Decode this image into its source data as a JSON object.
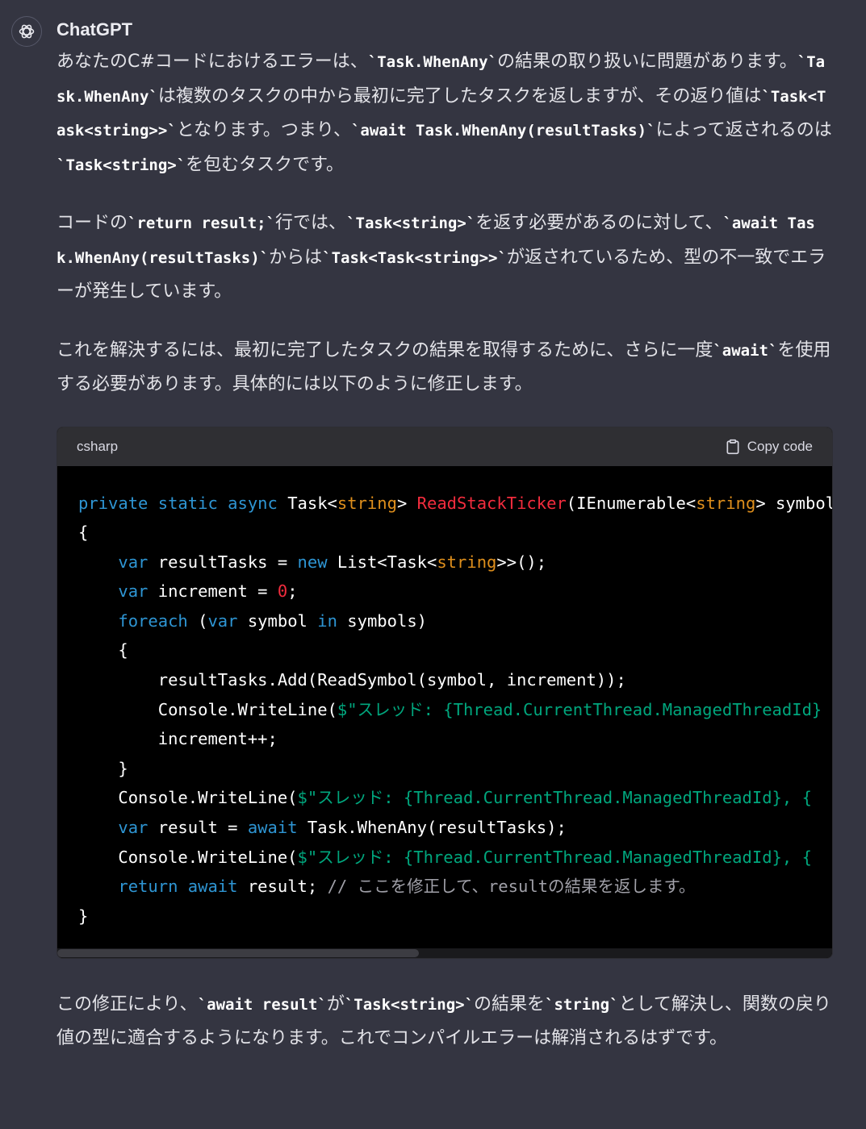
{
  "author": {
    "name": "ChatGPT",
    "avatar_icon": "openai-logo-icon"
  },
  "message": {
    "p1": {
      "t1": "あなたのC#コードにおけるエラーは、",
      "c1": "`Task.WhenAny`",
      "t2": "の結果の取り扱いに問題があります。",
      "c2": "`Task.WhenAny`",
      "t3": "は複数のタスクの中から最初に完了したタスクを返しますが、その返り値は",
      "c3": "`Task<Task<string>>`",
      "t4": "となります。つまり、",
      "c4": "`await Task.WhenAny(resultTasks)`",
      "t5": "によって返されるのは",
      "c5": "`Task<string>`",
      "t6": "を包むタスクです。"
    },
    "p2": {
      "t1": "コードの",
      "c1": "`return result;`",
      "t2": "行では、",
      "c2": "`Task<string>`",
      "t3": "を返す必要があるのに対して、",
      "c3": "`await Task.WhenAny(resultTasks)`",
      "t4": "からは",
      "c4": "`Task<Task<string>>`",
      "t5": "が返されているため、型の不一致でエラーが発生しています。"
    },
    "p3": {
      "t1": "これを解決するには、最初に完了したタスクの結果を取得するために、さらに一度",
      "c1": "`await`",
      "t2": "を使用する必要があります。具体的には以下のように修正します。"
    },
    "p4": {
      "t1": "この修正により、",
      "c1": "`await result`",
      "t2": "が",
      "c2": "`Task<string>`",
      "t3": "の結果を",
      "c3": "`string`",
      "t4": "として解決し、関数の戻り値の型に適合するようになります。これでコンパイルエラーは解消されるはずです。"
    }
  },
  "code_block": {
    "language": "csharp",
    "copy_label": "Copy code",
    "copy_icon": "clipboard-icon",
    "lines": [
      [
        [
          "kw",
          "private static async "
        ],
        [
          "",
          "Task<"
        ],
        [
          "ty",
          "string"
        ],
        [
          "",
          "> "
        ],
        [
          "fn",
          "ReadStackTicker"
        ],
        [
          "",
          "(IEnumerable<"
        ],
        [
          "ty",
          "string"
        ],
        [
          "",
          "> symbols)"
        ]
      ],
      [
        [
          "",
          "{"
        ]
      ],
      [
        [
          "",
          "    "
        ],
        [
          "kw",
          "var"
        ],
        [
          "",
          " resultTasks = "
        ],
        [
          "kw",
          "new"
        ],
        [
          "",
          " List<Task<"
        ],
        [
          "ty",
          "string"
        ],
        [
          "",
          ">>();"
        ]
      ],
      [
        [
          "",
          "    "
        ],
        [
          "kw",
          "var"
        ],
        [
          "",
          " increment = "
        ],
        [
          "num",
          "0"
        ],
        [
          "",
          ";"
        ]
      ],
      [
        [
          "",
          "    "
        ],
        [
          "kw",
          "foreach"
        ],
        [
          "",
          " ("
        ],
        [
          "kw",
          "var"
        ],
        [
          "",
          " symbol "
        ],
        [
          "kw",
          "in"
        ],
        [
          "",
          " symbols)"
        ]
      ],
      [
        [
          "",
          "    {"
        ]
      ],
      [
        [
          "",
          "        resultTasks.Add(ReadSymbol(symbol, increment));"
        ]
      ],
      [
        [
          "",
          "        Console.WriteLine("
        ],
        [
          "str",
          "$\"スレッド: {Thread.CurrentThread.ManagedThreadId}"
        ]
      ],
      [
        [
          "",
          "        increment++;"
        ]
      ],
      [
        [
          "",
          "    }"
        ]
      ],
      [
        [
          "",
          "    Console.WriteLine("
        ],
        [
          "str",
          "$\"スレッド: {Thread.CurrentThread.ManagedThreadId}, {"
        ]
      ],
      [
        [
          "",
          "    "
        ],
        [
          "kw",
          "var"
        ],
        [
          "",
          " result = "
        ],
        [
          "kw",
          "await"
        ],
        [
          "",
          " Task.WhenAny(resultTasks);"
        ]
      ],
      [
        [
          "",
          "    Console.WriteLine("
        ],
        [
          "str",
          "$\"スレッド: {Thread.CurrentThread.ManagedThreadId}, {"
        ]
      ],
      [
        [
          "",
          "    "
        ],
        [
          "kw",
          "return await"
        ],
        [
          "",
          " result; "
        ],
        [
          "cm",
          "// ここを修正して、resultの結果を返します。"
        ]
      ],
      [
        [
          "",
          "}"
        ]
      ]
    ]
  }
}
